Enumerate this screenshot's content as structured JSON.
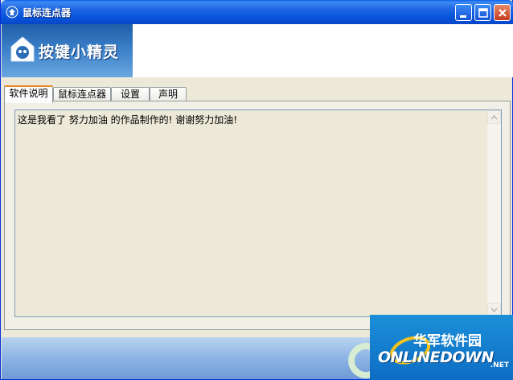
{
  "window": {
    "title": "鼠标连点器"
  },
  "banner": {
    "logo_text": "按键小精灵"
  },
  "tabs": [
    {
      "label": "软件说明",
      "active": true
    },
    {
      "label": "鼠标连点器",
      "active": false
    },
    {
      "label": "设置",
      "active": false
    },
    {
      "label": "声明",
      "active": false
    }
  ],
  "content": {
    "text": "这是我看了 努力加油 的作品制作的! 谢谢努力加油!"
  },
  "watermark": {
    "cn": "华军软件园",
    "en": "ONLINEDOWN",
    "suffix": ".NET"
  },
  "colors": {
    "titlebar": "#0855dd",
    "tab_accent": "#e68b2c",
    "panel_bg": "#ece9d8"
  }
}
